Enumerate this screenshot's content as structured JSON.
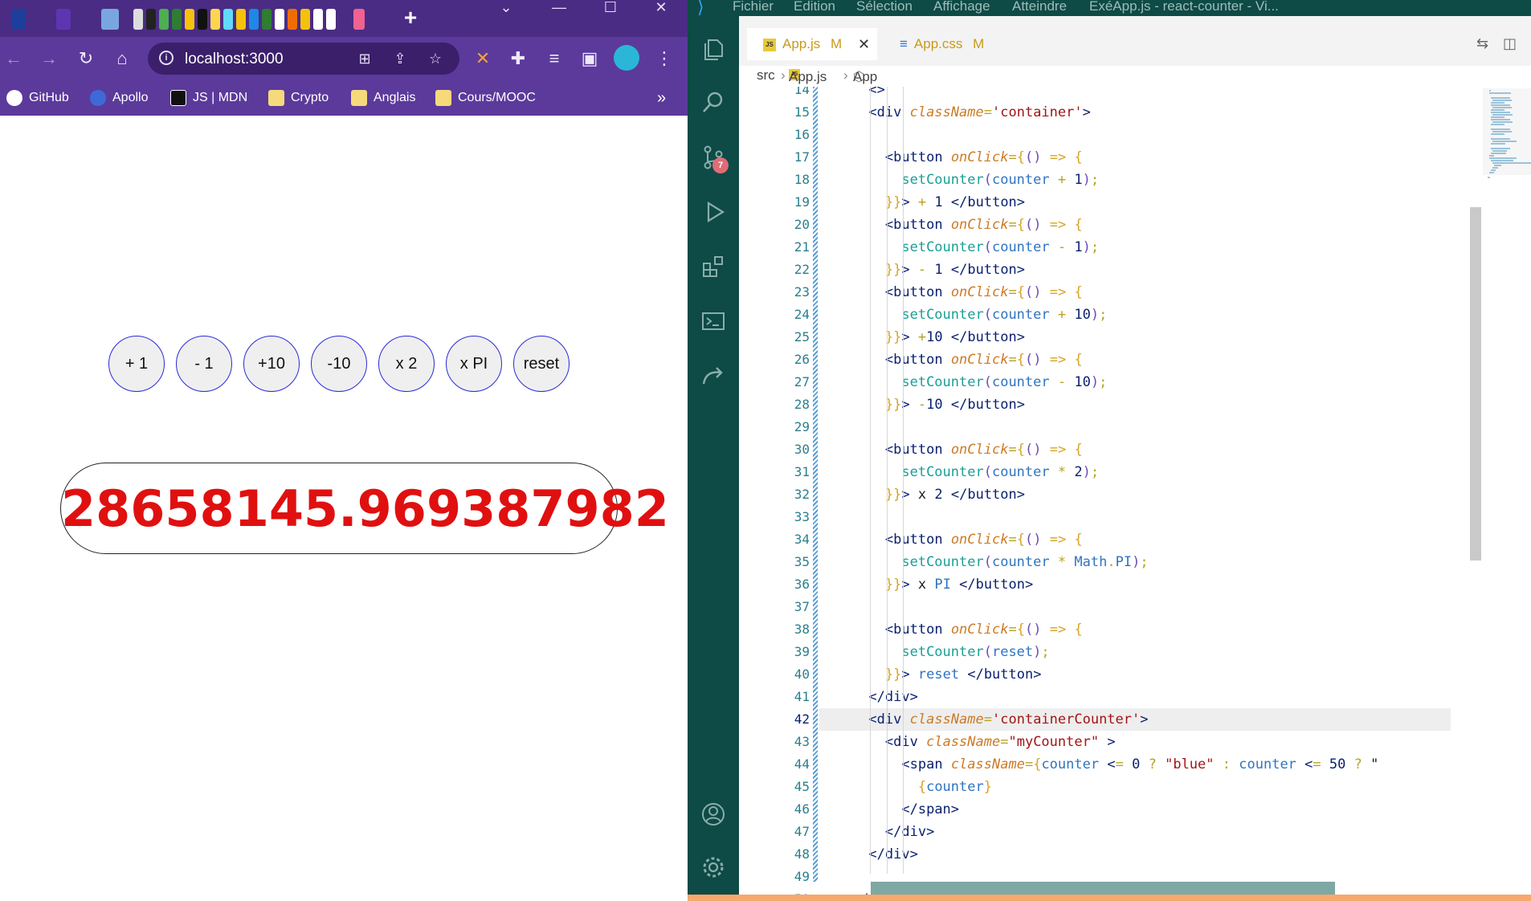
{
  "browser": {
    "url": "localhost:3000",
    "bookmarks": [
      {
        "label": "GitHub",
        "icon": "github-icon"
      },
      {
        "label": "Apollo",
        "icon": "apollo-icon"
      },
      {
        "label": "JS | MDN",
        "icon": "mdn-icon"
      },
      {
        "label": "Crypto",
        "icon": "folder-icon"
      },
      {
        "label": "Anglais",
        "icon": "folder-icon"
      },
      {
        "label": "Cours/MOOC",
        "icon": "folder-icon"
      }
    ],
    "more_bookmarks": "»",
    "new_tab": "+"
  },
  "app": {
    "buttons": [
      "+ 1",
      "- 1",
      "+10",
      "-10",
      "x 2",
      "x PI",
      "reset"
    ],
    "counter_value": "28658145.969387982",
    "counter_color": "#e01010"
  },
  "vscode": {
    "menu": [
      "Fichier",
      "Edition",
      "Sélection",
      "Affichage",
      "Atteindre",
      "ExéApp.js - react-counter - Vi..."
    ],
    "tabs": [
      {
        "label": "App.js",
        "status": "M",
        "active": true
      },
      {
        "label": "App.css",
        "status": "M",
        "active": false
      }
    ],
    "breadcrumb": [
      "src",
      "App.js",
      "App"
    ],
    "scm_badge": "7",
    "current_line": 42,
    "line_numbers": [
      "14",
      "15",
      "16",
      "17",
      "18",
      "19",
      "20",
      "21",
      "22",
      "23",
      "24",
      "25",
      "26",
      "27",
      "28",
      "29",
      "30",
      "31",
      "32",
      "33",
      "34",
      "35",
      "36",
      "37",
      "38",
      "39",
      "40",
      "41",
      "42",
      "43",
      "44",
      "45",
      "46",
      "47",
      "48",
      "49",
      "50"
    ],
    "code_lines": [
      "      <>",
      "      <div className='container'>",
      "",
      "        <button onClick={() => {",
      "          setCounter(counter + 1);",
      "        }}> + 1 </button>",
      "        <button onClick={() => {",
      "          setCounter(counter - 1);",
      "        }}> - 1 </button>",
      "        <button onClick={() => {",
      "          setCounter(counter + 10);",
      "        }}> +10 </button>",
      "        <button onClick={() => {",
      "          setCounter(counter - 10);",
      "        }}> -10 </button>",
      "",
      "        <button onClick={() => {",
      "          setCounter(counter * 2);",
      "        }}> x 2 </button>",
      "",
      "        <button onClick={() => {",
      "          setCounter(counter * Math.PI);",
      "        }}> x PI </button>",
      "",
      "        <button onClick={() => {",
      "          setCounter(reset);",
      "        }}> reset </button>",
      "      </div>",
      "      <div className='containerCounter'>",
      "        <div className=\"myCounter\" >",
      "          <span className={counter <= 0 ? \"blue\" : counter <= 50 ? \"",
      "            {counter}",
      "          </span>",
      "        </div>",
      "      </div>",
      "",
      "    </>"
    ]
  }
}
